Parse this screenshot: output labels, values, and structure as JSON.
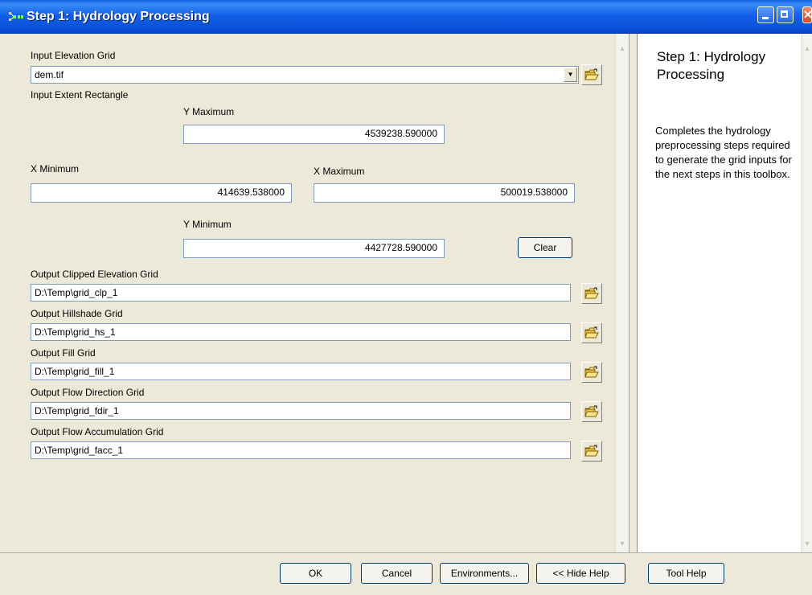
{
  "window": {
    "title": "Step 1: Hydrology Processing"
  },
  "form": {
    "input_elevation_grid": {
      "label": "Input Elevation Grid",
      "value": "dem.tif"
    },
    "extent": {
      "label": "Input Extent Rectangle",
      "y_max_label": "Y Maximum",
      "y_max": "4539238.590000",
      "x_min_label": "X Minimum",
      "x_min": "414639.538000",
      "x_max_label": "X Maximum",
      "x_max": "500019.538000",
      "y_min_label": "Y Minimum",
      "y_min": "4427728.590000",
      "clear_label": "Clear"
    },
    "outputs": [
      {
        "label": "Output Clipped Elevation Grid",
        "value": "D:\\Temp\\grid_clp_1"
      },
      {
        "label": "Output Hillshade Grid",
        "value": "D:\\Temp\\grid_hs_1"
      },
      {
        "label": "Output Fill Grid",
        "value": "D:\\Temp\\grid_fill_1"
      },
      {
        "label": "Output Flow Direction Grid",
        "value": "D:\\Temp\\grid_fdir_1"
      },
      {
        "label": "Output Flow Accumulation Grid",
        "value": "D:\\Temp\\grid_facc_1"
      }
    ]
  },
  "help": {
    "title": "Step 1: Hydrology Processing",
    "body": "Completes the hydrology preprocessing steps required to generate the grid inputs for the next steps in this toolbox."
  },
  "buttons": {
    "ok": "OK",
    "cancel": "Cancel",
    "environments": "Environments...",
    "hide_help": "<< Hide Help",
    "tool_help": "Tool Help"
  },
  "icons": {
    "app": "toolbox-model-icon",
    "browse": "open-folder-icon"
  }
}
